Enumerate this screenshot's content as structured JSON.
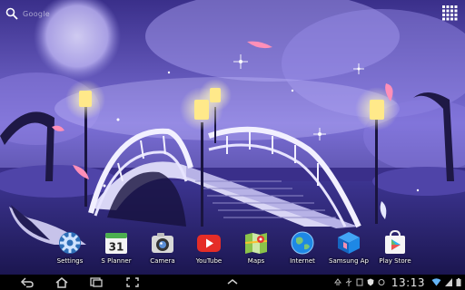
{
  "search": {
    "hint": "Google"
  },
  "dock": {
    "apps": [
      {
        "label": "Settings",
        "icon": "settings-icon"
      },
      {
        "label": "S Planner",
        "icon": "calendar-icon",
        "badge": "31"
      },
      {
        "label": "Camera",
        "icon": "camera-icon"
      },
      {
        "label": "YouTube",
        "icon": "youtube-icon"
      },
      {
        "label": "Maps",
        "icon": "maps-icon"
      },
      {
        "label": "Internet",
        "icon": "globe-icon"
      },
      {
        "label": "Samsung Ap",
        "icon": "samsung-apps-icon"
      },
      {
        "label": "Play Store",
        "icon": "play-store-icon"
      }
    ]
  },
  "status": {
    "time": "13:13"
  },
  "colors": {
    "sky": "#6a5acd",
    "lamp": "#ffe98a",
    "nav": "#000000"
  }
}
